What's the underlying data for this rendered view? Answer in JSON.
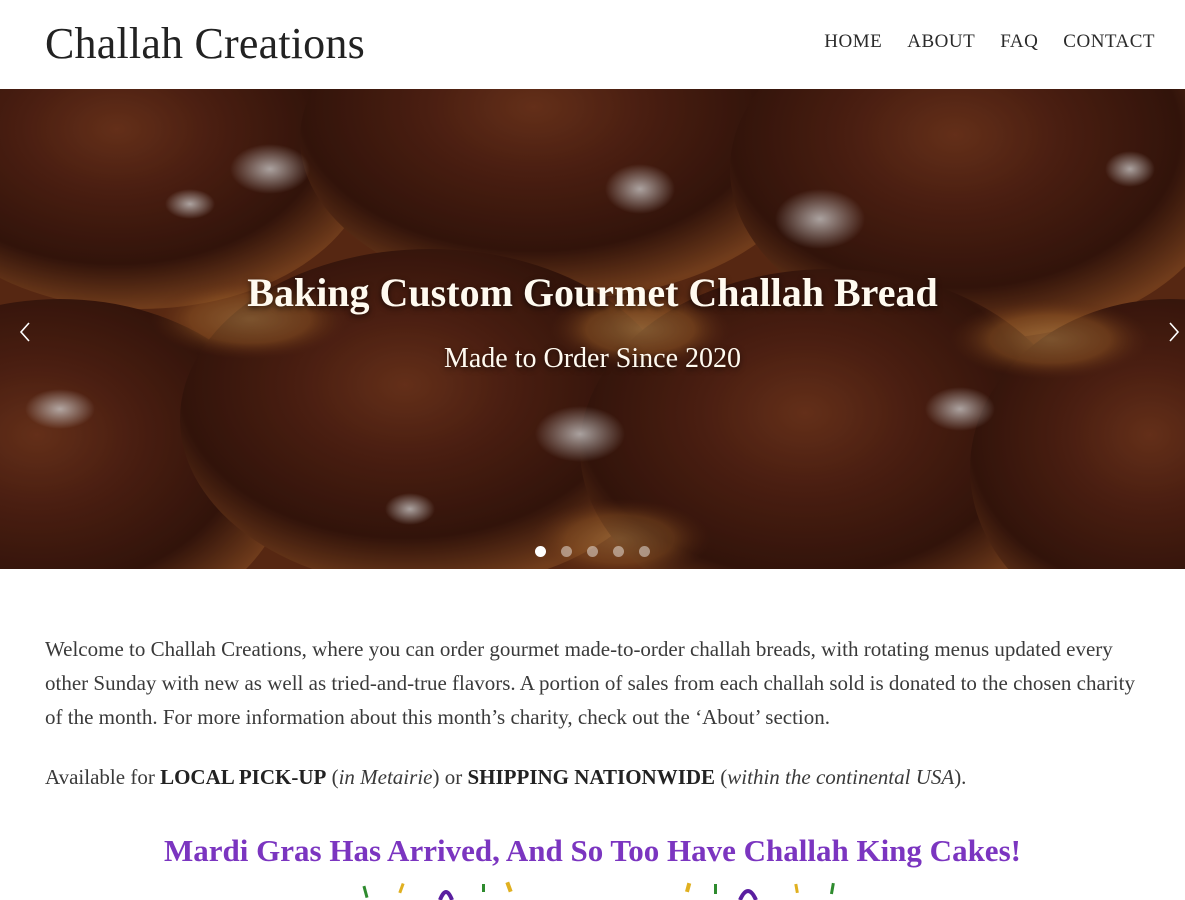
{
  "site": {
    "title": "Challah Creations"
  },
  "nav": {
    "items": [
      "HOME",
      "ABOUT",
      "FAQ",
      "CONTACT"
    ]
  },
  "hero": {
    "title": "Baking Custom Gourmet Challah Bread",
    "subtitle": "Made to Order Since 2020",
    "slide_count": 5,
    "active_slide": 1
  },
  "content": {
    "welcome": "Welcome to Challah Creations, where you can order gourmet made-to-order challah breads, with rotating menus updated every other Sunday with new as well as tried-and-true flavors. A portion of sales from each challah sold is donated to the chosen charity of the month. For more information about this month’s charity, check out the ‘About’ section.",
    "avail_prefix": "Available for ",
    "avail_local": "LOCAL PICK-UP",
    "avail_open1": " (",
    "avail_local_where": "in Metairie",
    "avail_mid": ") or ",
    "avail_ship": "SHIPPING NATIONWIDE",
    "avail_open2": " (",
    "avail_ship_where": "within the continental USA",
    "avail_end": ").",
    "promo": "Mardi Gras Has Arrived, And So Too Have Challah King Cakes!"
  },
  "icons": {
    "prev": "chevron-left-icon",
    "next": "chevron-right-icon"
  },
  "colors": {
    "promo": "#7b35c0",
    "hero_text": "#fffaf0"
  }
}
